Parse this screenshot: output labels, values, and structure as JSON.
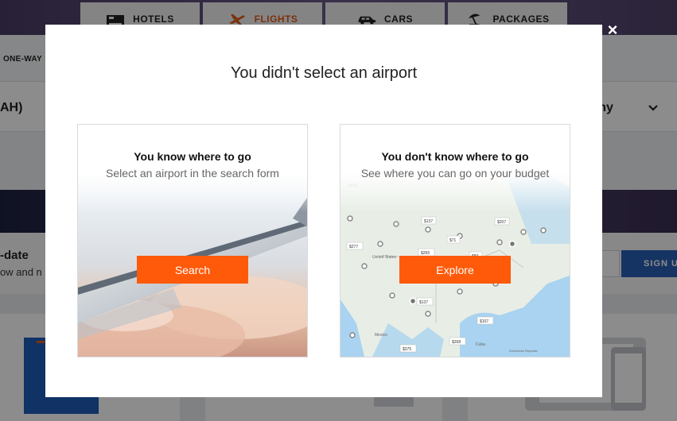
{
  "product_tabs": [
    {
      "label": "HOTELS",
      "icon": "bed-icon",
      "active": false
    },
    {
      "label": "FLIGHTS",
      "icon": "plane-icon",
      "active": true
    },
    {
      "label": "CARS",
      "icon": "car-icon",
      "active": false
    },
    {
      "label": "PACKAGES",
      "icon": "beach-umbrella-icon",
      "active": false
    }
  ],
  "trip_type": "ONE-WAY",
  "search": {
    "origin_fragment": "AH)",
    "cabin_fragment": "omy"
  },
  "newsletter": {
    "heading_fragment": "-date",
    "body_fragment": "ow and n",
    "signup_label": "SIGN U"
  },
  "modal": {
    "title": "You didn't select an airport",
    "close_symbol": "×",
    "options": [
      {
        "title": "You know where to go",
        "subtitle": "Select an airport in the search form",
        "button": "Search"
      },
      {
        "title": "You don't know where to go",
        "subtitle": "See where you can go on your budget",
        "button": "Explore"
      }
    ],
    "map_labels": {
      "countries": [
        "United States",
        "Mexico",
        "Cuba",
        "Dominican Republic"
      ],
      "prices": [
        "$137",
        "$207",
        "$277",
        "$71",
        "$265",
        "$83",
        "$137",
        "$107",
        "$268",
        "$375"
      ]
    }
  },
  "colors": {
    "accent_orange": "#ff5a0a",
    "flights_tab": "#e05a16",
    "signup_blue": "#2960b5"
  }
}
